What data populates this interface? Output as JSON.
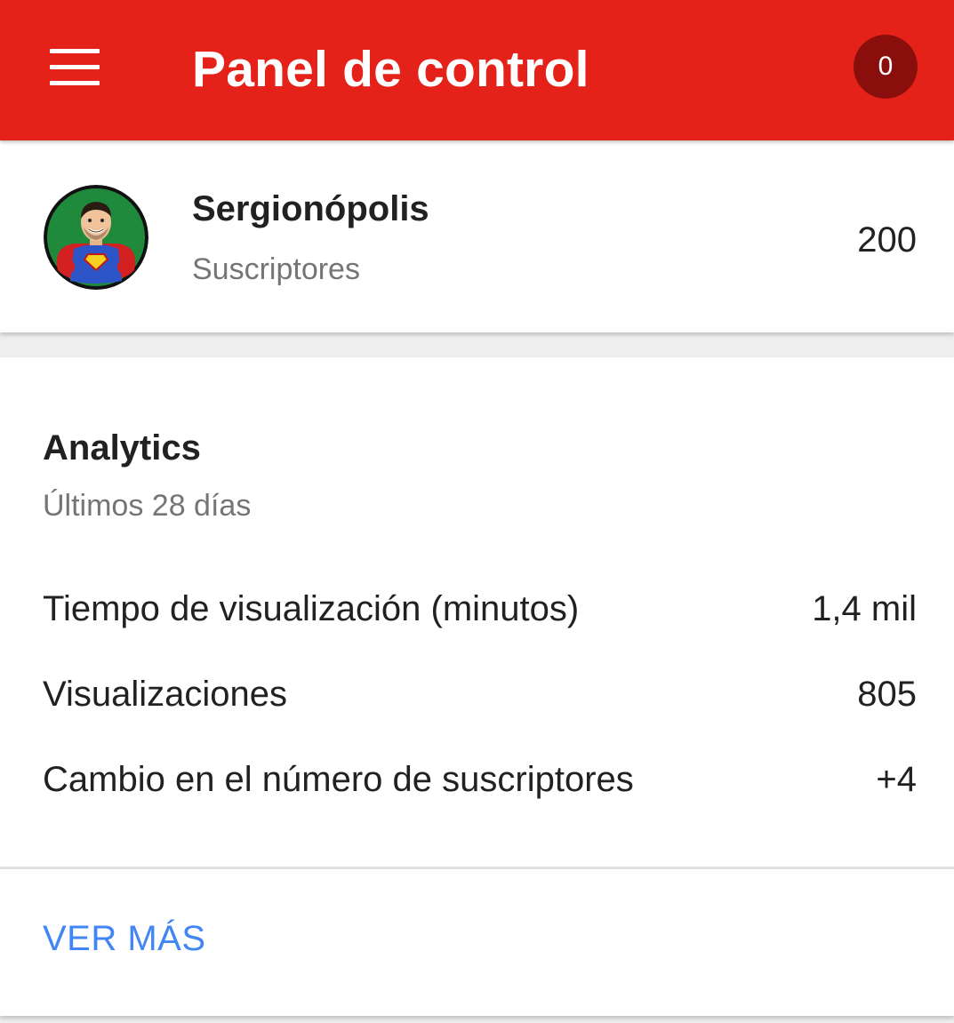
{
  "appbar": {
    "title": "Panel de control",
    "menu_icon": "hamburger-menu-icon",
    "notification_count": "0",
    "color": "#e52219"
  },
  "channel": {
    "name": "Sergionópolis",
    "subscribers_label": "Suscriptores",
    "subscribers_count": "200"
  },
  "analytics": {
    "title": "Analytics",
    "period": "Últimos 28 días",
    "metrics": [
      {
        "label": "Tiempo de visualización (minutos)",
        "value": "1,4 mil"
      },
      {
        "label": "Visualizaciones",
        "value": "805"
      },
      {
        "label": "Cambio en el número de suscriptores",
        "value": "+4"
      }
    ],
    "see_more": "VER MÁS",
    "link_color": "#4285f4"
  }
}
